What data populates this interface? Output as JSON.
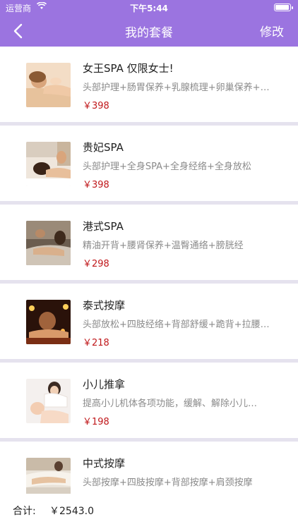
{
  "status_bar": {
    "carrier": "运营商",
    "time": "下午5:44"
  },
  "nav": {
    "title": "我的套餐",
    "edit_label": "修改"
  },
  "packages": [
    {
      "name": "女王SPA  仅限女士!",
      "description": "头部护理+肠胃保养+乳腺梳理+卵巢保养+…",
      "price": "￥398"
    },
    {
      "name": "贵妃SPA",
      "description": "头部护理+全身SPA+全身经络+全身放松",
      "price": "￥398"
    },
    {
      "name": "港式SPA",
      "description": "精油开背+腰肾保养+温臀通络+膀胱经",
      "price": "￥298"
    },
    {
      "name": "泰式按摩",
      "description": "头部放松+四肢经络+背部舒缓+跪背+拉腰…",
      "price": "￥218"
    },
    {
      "name": "小儿推拿",
      "description": "提高小儿机体各项功能，缓解、解除小儿…",
      "price": "￥198"
    },
    {
      "name": "中式按摩",
      "description": "头部按摩+四肢按摩+背部按摩+肩颈按摩",
      "price": ""
    }
  ],
  "footer": {
    "total_label": "合计:",
    "total_value": "￥2543.0"
  },
  "colors": {
    "nav_bg": "#9b74e0",
    "price": "#c0181b",
    "separator": "#e5e2ee"
  }
}
